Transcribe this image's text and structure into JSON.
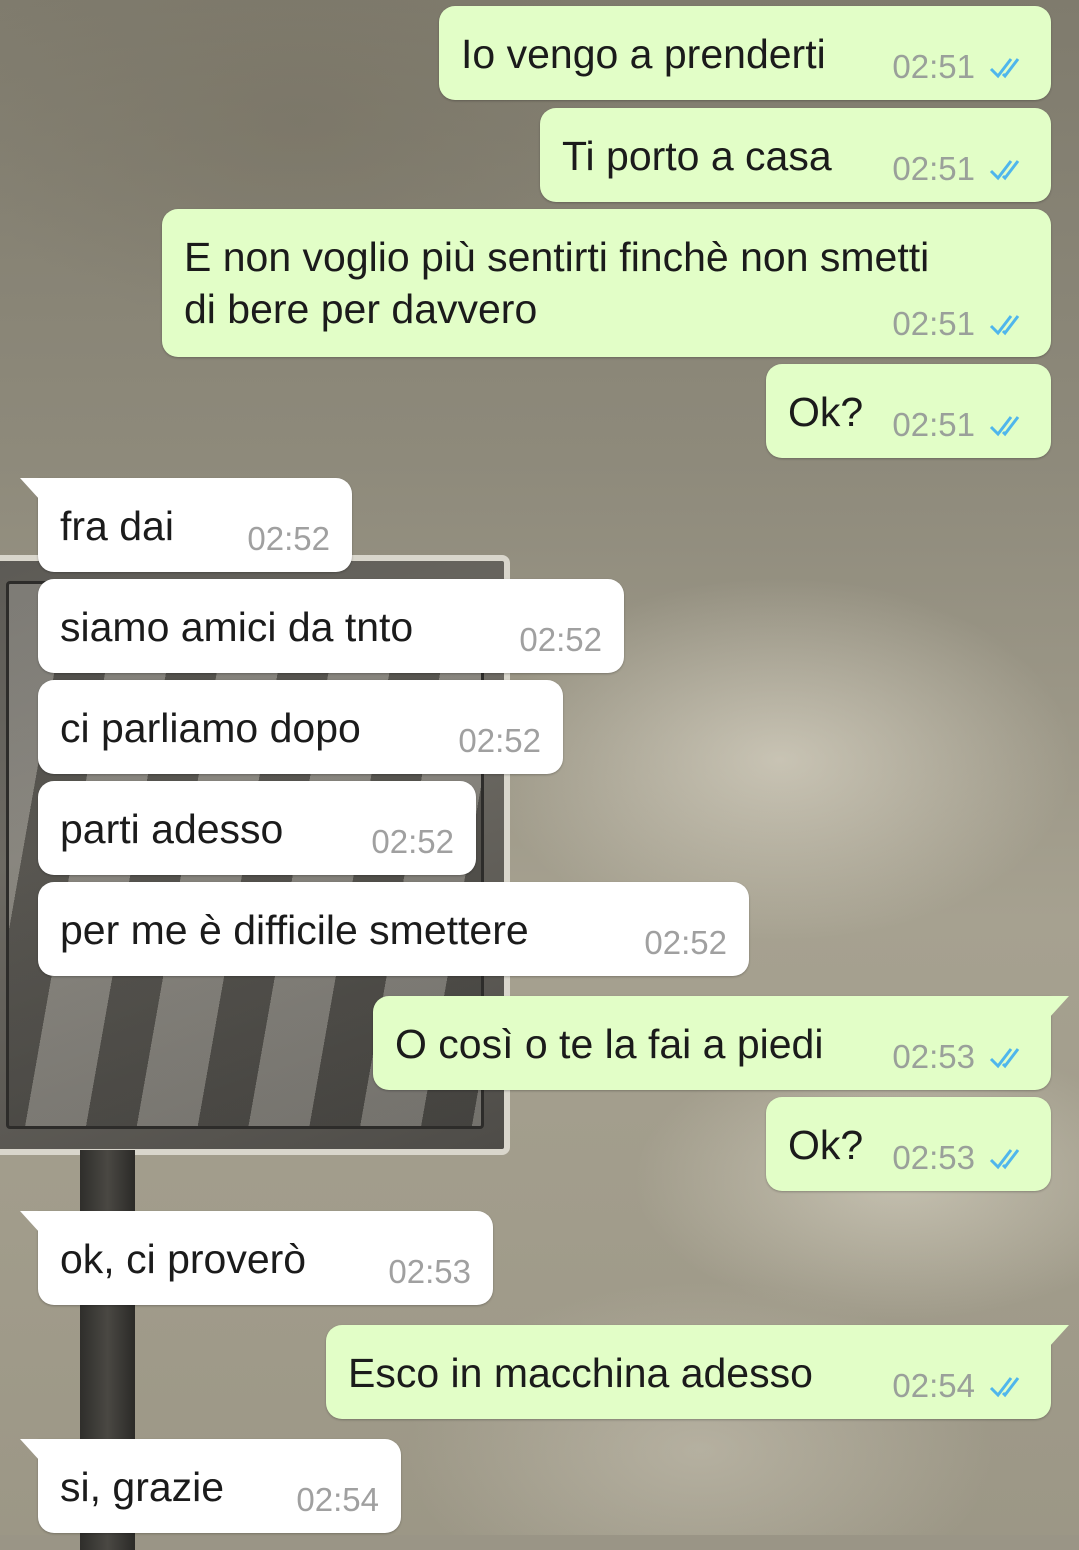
{
  "messages": [
    {
      "direction": "out",
      "text": "Io vengo a prenderti",
      "time": "02:51",
      "status": "read-double-check-icon"
    },
    {
      "direction": "out",
      "text": "Ti porto a casa",
      "time": "02:51",
      "status": "read-double-check-icon"
    },
    {
      "direction": "out",
      "text": "E non voglio più sentirti finchè non smetti\ndi bere per davvero",
      "time": "02:51",
      "status": "read-double-check-icon"
    },
    {
      "direction": "out",
      "text": "Ok?",
      "time": "02:51",
      "status": "read-double-check-icon"
    },
    {
      "direction": "in",
      "text": "fra dai",
      "time": "02:52"
    },
    {
      "direction": "in",
      "text": "siamo amici da tnto",
      "time": "02:52"
    },
    {
      "direction": "in",
      "text": "ci parliamo dopo",
      "time": "02:52"
    },
    {
      "direction": "in",
      "text": "parti adesso",
      "time": "02:52"
    },
    {
      "direction": "in",
      "text": "per me è difficile smettere",
      "time": "02:52"
    },
    {
      "direction": "out",
      "text": "O così o te la fai a piedi",
      "time": "02:53",
      "status": "read-double-check-icon"
    },
    {
      "direction": "out",
      "text": "Ok?",
      "time": "02:53",
      "status": "read-double-check-icon"
    },
    {
      "direction": "in",
      "text": "ok, ci proverò",
      "time": "02:53"
    },
    {
      "direction": "out",
      "text": "Esco in macchina adesso",
      "time": "02:54",
      "status": "read-double-check-icon"
    },
    {
      "direction": "in",
      "text": "si, grazie",
      "time": "02:54"
    }
  ],
  "colors": {
    "outgoing_bubble": "#e2fec7",
    "incoming_bubble": "#ffffff",
    "read_ticks": "#4fb6ec",
    "timestamp": "#9aa09a"
  }
}
